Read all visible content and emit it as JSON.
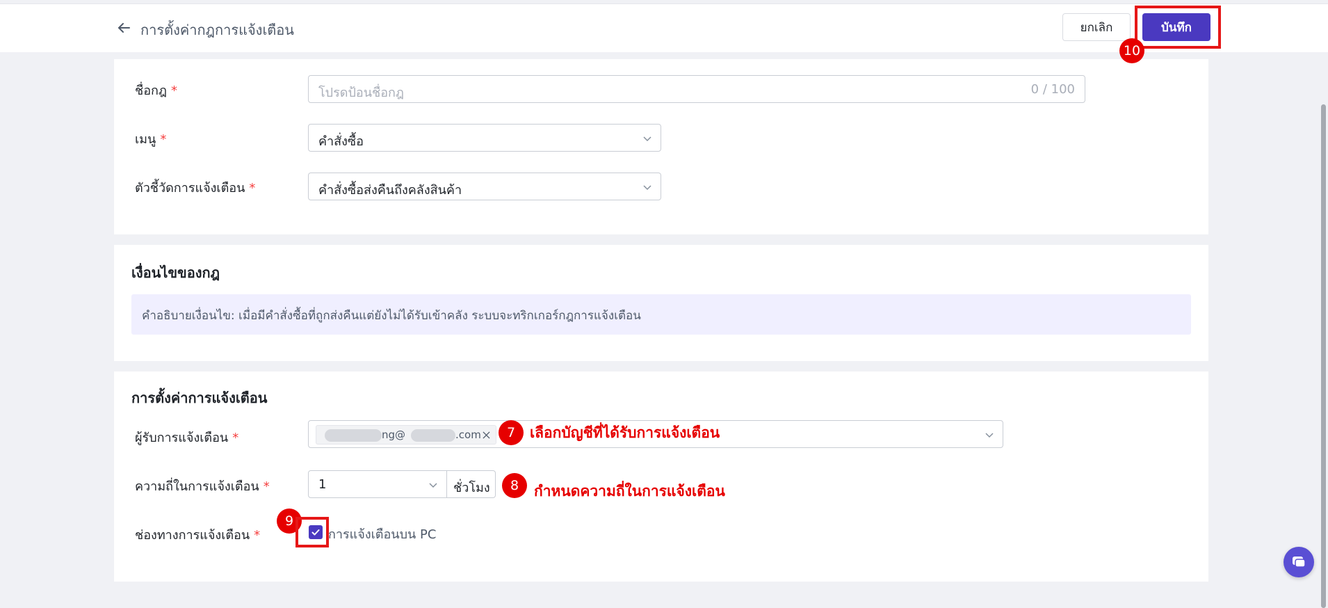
{
  "header": {
    "title": "การตั้งค่ากฎการแจ้งเตือน",
    "cancel_label": "ยกเลิก",
    "save_label": "บันทึก"
  },
  "basic": {
    "rule_name_label": "ชื่อกฎ",
    "rule_name_placeholder": "โปรดป้อนชื่อกฎ",
    "rule_name_counter": "0 / 100",
    "menu_label": "เมนู",
    "menu_value": "คำสั่งซื้อ",
    "indicator_label": "ตัวชี้วัดการแจ้งเตือน",
    "indicator_value": "คำสั่งซื้อส่งคืนถึงคลังสินค้า"
  },
  "condition": {
    "title": "เงื่อนไขของกฎ",
    "description": "คำอธิบายเงื่อนไข: เมื่อมีคำสั่งซื้อที่ถูกส่งคืนแต่ยังไม่ได้รับเข้าคลัง ระบบจะทริกเกอร์กฎการแจ้งเตือน"
  },
  "notify": {
    "title": "การตั้งค่าการแจ้งเตือน",
    "recipient_label": "ผู้รับการแจ้งเตือน",
    "recipient_tag_part1": "ng@",
    "recipient_tag_part2": ".com",
    "frequency_label": "ความถี่ในการแจ้งเตือน",
    "frequency_value": "1",
    "frequency_unit": "ชั่วโมง",
    "channel_label": "ช่องทางการแจ้งเตือน",
    "channel_option": "การแจ้งเตือนบน PC"
  },
  "required_mark": "*",
  "annotations": {
    "step7": "7",
    "step7_text": "เลือกบัญชีที่ได้รับการแจ้งเตือน",
    "step8": "8",
    "step8_text": "กำหนดความถี่ในการแจ้งเตือน",
    "step9": "9",
    "step10": "10"
  },
  "colors": {
    "primary": "#4a39c0",
    "annotation_red": "#e60000",
    "required_red": "#f53f3f"
  }
}
